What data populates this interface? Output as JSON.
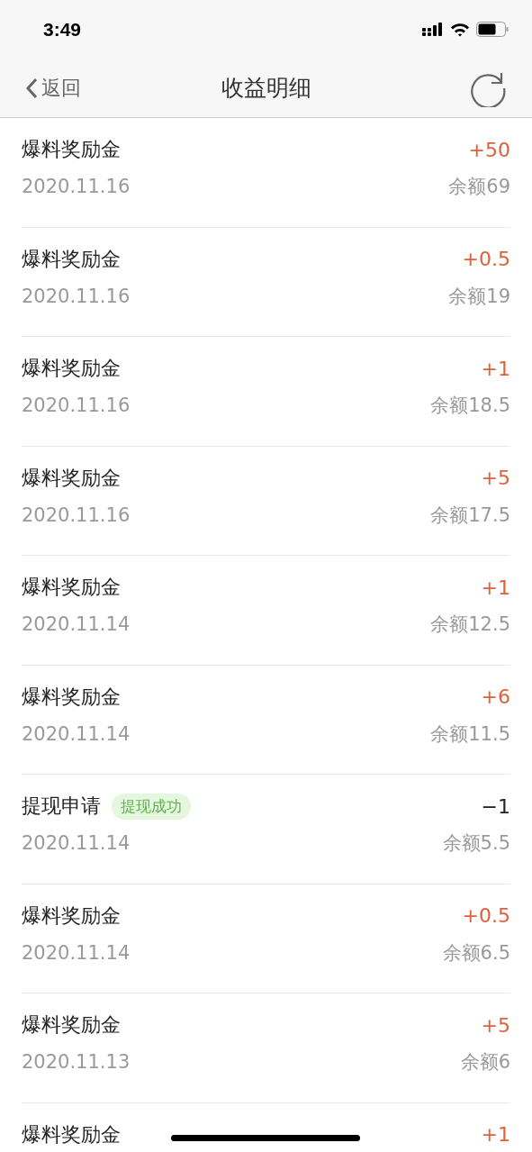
{
  "status_bar": {
    "time": "3:49"
  },
  "nav": {
    "back": "返回",
    "title": "收益明细"
  },
  "records": [
    {
      "title": "爆料奖励金",
      "kind": "income",
      "amount": "+50",
      "date": "2020.11.16",
      "balance": "余额69"
    },
    {
      "title": "爆料奖励金",
      "kind": "income",
      "amount": "+0.5",
      "date": "2020.11.16",
      "balance": "余额19"
    },
    {
      "title": "爆料奖励金",
      "kind": "income",
      "amount": "+1",
      "date": "2020.11.16",
      "balance": "余额18.5"
    },
    {
      "title": "爆料奖励金",
      "kind": "income",
      "amount": "+5",
      "date": "2020.11.16",
      "balance": "余额17.5"
    },
    {
      "title": "爆料奖励金",
      "kind": "income",
      "amount": "+1",
      "date": "2020.11.14",
      "balance": "余额12.5"
    },
    {
      "title": "爆料奖励金",
      "kind": "income",
      "amount": "+6",
      "date": "2020.11.14",
      "balance": "余额11.5"
    },
    {
      "title": "提现申请",
      "kind": "expense",
      "badge": "提现成功",
      "amount": "−1",
      "date": "2020.11.14",
      "balance": "余额5.5"
    },
    {
      "title": "爆料奖励金",
      "kind": "income",
      "amount": "+0.5",
      "date": "2020.11.14",
      "balance": "余额6.5"
    },
    {
      "title": "爆料奖励金",
      "kind": "income",
      "amount": "+5",
      "date": "2020.11.13",
      "balance": "余额6"
    },
    {
      "title": "爆料奖励金",
      "kind": "income",
      "amount": "+1"
    }
  ]
}
